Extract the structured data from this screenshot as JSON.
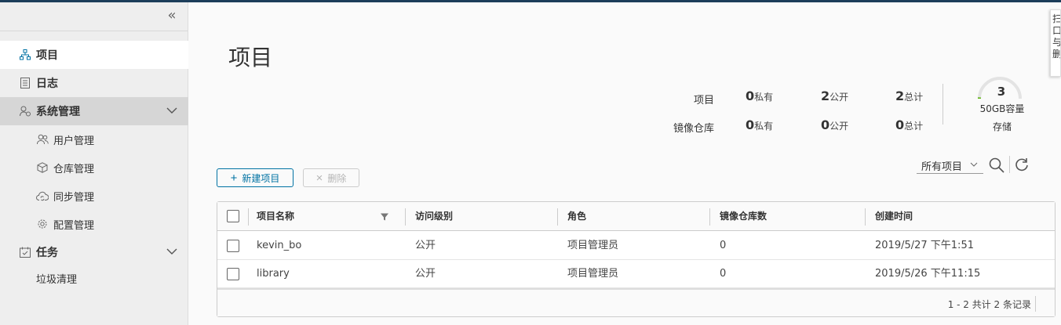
{
  "sidebar": {
    "collapse_icon": "double-chevron-left-icon",
    "items": [
      {
        "label": "项目",
        "icon": "project-tree-icon"
      },
      {
        "label": "日志",
        "icon": "log-icon"
      },
      {
        "label": "系统管理",
        "icon": "user-settings-icon"
      },
      {
        "label": "用户管理",
        "icon": "users-icon"
      },
      {
        "label": "仓库管理",
        "icon": "cube-icon"
      },
      {
        "label": "同步管理",
        "icon": "cloud-sync-icon"
      },
      {
        "label": "配置管理",
        "icon": "gear-icon"
      },
      {
        "label": "任务",
        "icon": "calendar-check-icon"
      },
      {
        "label": "垃圾清理"
      }
    ]
  },
  "main": {
    "title": "项目",
    "stats": {
      "projects_label": "项目",
      "repos_label": "镜像仓库",
      "projects": {
        "private": "0",
        "public": "2",
        "total": "2"
      },
      "repos": {
        "private": "0",
        "public": "0",
        "total": "0"
      },
      "private_label": "私有",
      "public_label": "公开",
      "total_label": "总计"
    },
    "storage": {
      "value": "3",
      "capacity": "50GB容量",
      "label": "存储",
      "used_fraction": 0.02
    },
    "toolbar": {
      "new_label": "新建项目",
      "delete_label": "删除",
      "filter_value": "所有项目"
    },
    "table": {
      "columns": [
        "项目名称",
        "访问级别",
        "角色",
        "镜像仓库数",
        "创建时间"
      ],
      "rows": [
        {
          "name": "kevin_bo",
          "access": "公开",
          "role": "项目管理员",
          "repos": "0",
          "created": "2019/5/27 下午1:51"
        },
        {
          "name": "library",
          "access": "公开",
          "role": "项目管理员",
          "repos": "0",
          "created": "2019/5/26 下午11:15"
        }
      ],
      "footer": "1 - 2 共计 2 条记录"
    }
  },
  "side_tab": {
    "text": "扫口与删"
  },
  "colors": {
    "accent": "#0072a3",
    "topbar": "#1c3d5a",
    "gauge_fill": "#60b515"
  }
}
